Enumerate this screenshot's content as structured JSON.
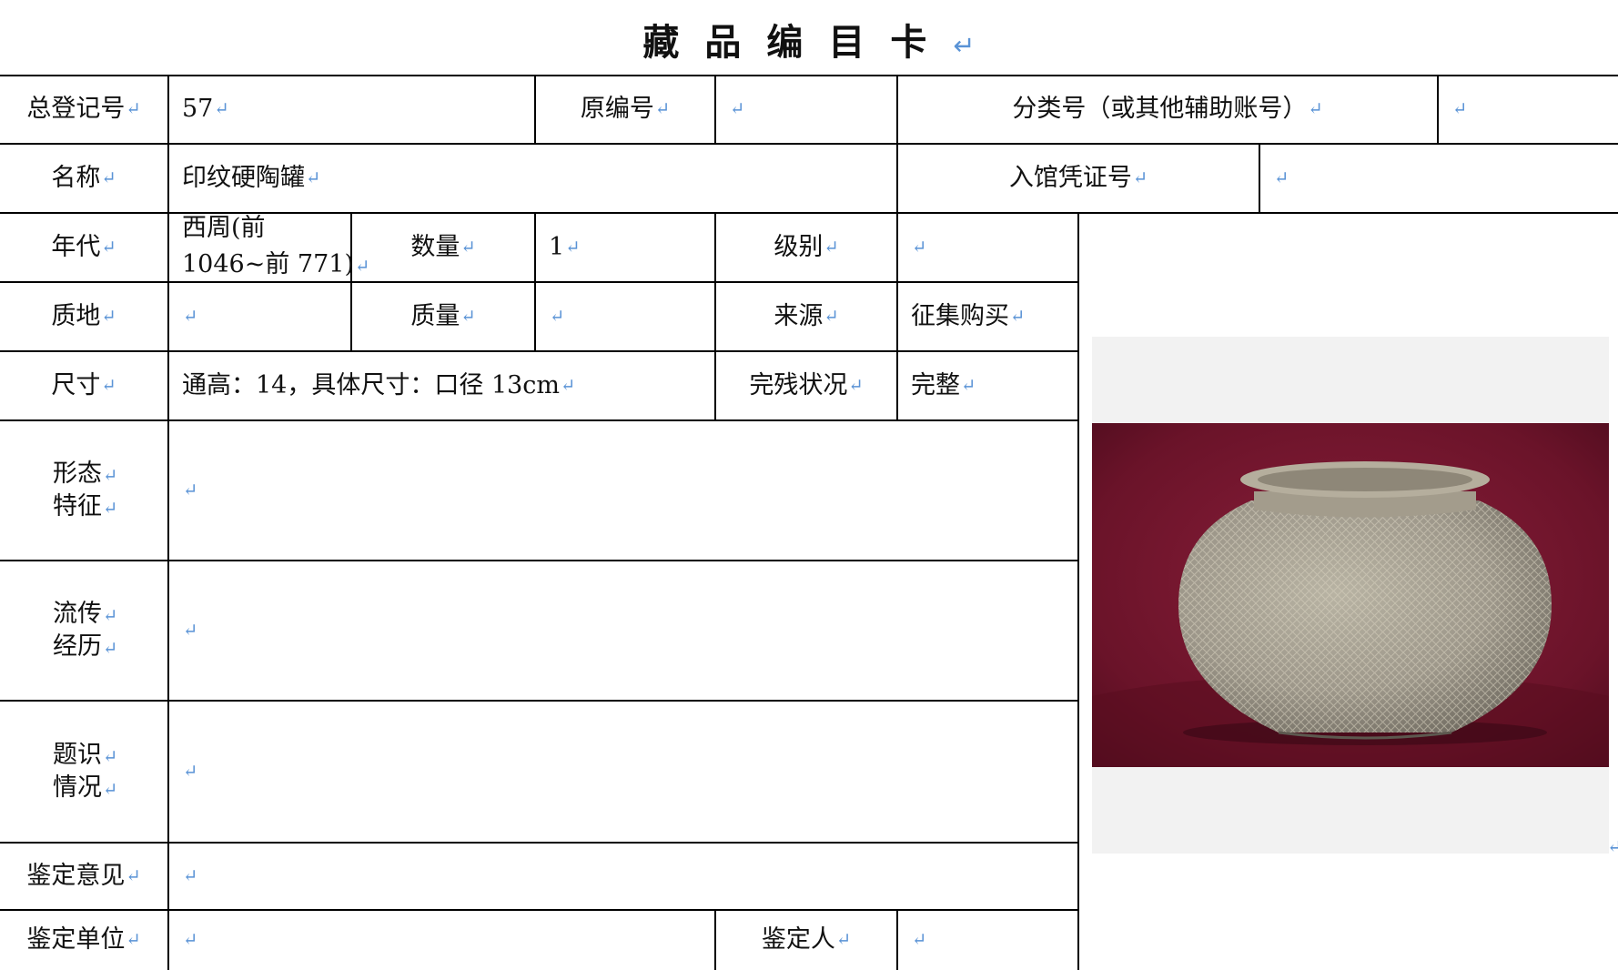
{
  "card_title": "藏品编目卡",
  "return_mark": "↵",
  "fields": {
    "total_reg_no": {
      "label": "总登记号",
      "value": "57"
    },
    "original_no": {
      "label": "原编号",
      "value": ""
    },
    "class_no": {
      "label": "分类号（或其他辅助账号）",
      "value": ""
    },
    "name": {
      "label": "名称",
      "value": "印纹硬陶罐"
    },
    "entry_voucher": {
      "label": "入馆凭证号",
      "value": ""
    },
    "era": {
      "label": "年代",
      "value_line1": "西周(前",
      "value_line2": "1046~前 771)"
    },
    "quantity": {
      "label": "数量",
      "value": "1"
    },
    "grade": {
      "label": "级别",
      "value": ""
    },
    "material": {
      "label": "质地",
      "value": ""
    },
    "weight": {
      "label": "质量",
      "value": ""
    },
    "source": {
      "label": "来源",
      "value": "征集购买"
    },
    "size": {
      "label": "尺寸",
      "value": "通高：14，具体尺寸：口径 13cm"
    },
    "condition": {
      "label": "完残状况",
      "value": "完整"
    },
    "morphology": {
      "label_line1": "形态",
      "label_line2": "特征",
      "value": ""
    },
    "provenance": {
      "label_line1": "流传",
      "label_line2": "经历",
      "value": ""
    },
    "inscription": {
      "label_line1": "题识",
      "label_line2": "情况",
      "value": ""
    },
    "appraisal_opinion": {
      "label": "鉴定意见",
      "value": ""
    },
    "appraisal_unit": {
      "label": "鉴定单位",
      "value": ""
    },
    "appraiser": {
      "label": "鉴定人",
      "value": ""
    }
  },
  "photo": {
    "subject": "gray stamped-pattern stoneware jar on dark red velvet cloth"
  },
  "colors": {
    "return_mark": "#5a93d6",
    "backdrop": "#6a1329",
    "rule": "#000000"
  }
}
